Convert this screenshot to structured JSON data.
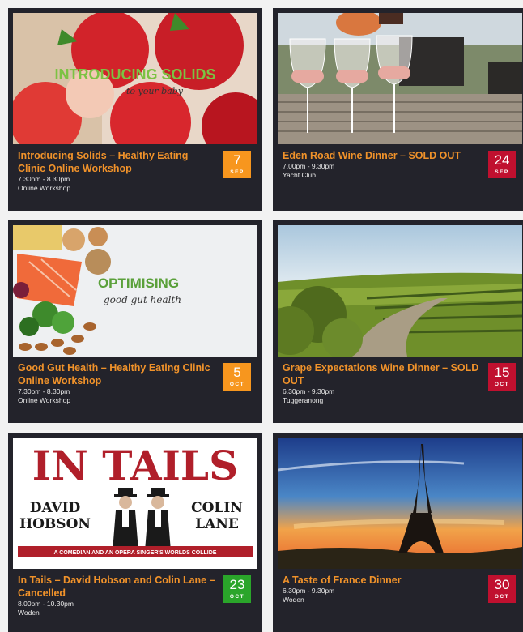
{
  "events": [
    {
      "title": "Introducing Solids – Healthy Eating Clinic Online Workshop",
      "time": "7.30pm - 8.30pm",
      "venue": "Online Workshop",
      "day": "7",
      "month": "SEP",
      "badge_color": "#f7961e",
      "image": {
        "heading": "INTRODUCING SOLIDS",
        "subheading": "to your baby"
      }
    },
    {
      "title": "Eden Road Wine Dinner – SOLD OUT",
      "time": "7.00pm - 9.30pm",
      "venue": "Yacht Club",
      "day": "24",
      "month": "SEP",
      "badge_color": "#c0102f"
    },
    {
      "title": "Good Gut Health – Healthy Eating Clinic Online Workshop",
      "time": "7.30pm - 8.30pm",
      "venue": "Online Workshop",
      "day": "5",
      "month": "OCT",
      "badge_color": "#f7961e",
      "image": {
        "heading": "OPTIMISING",
        "subheading": "good gut health"
      }
    },
    {
      "title": "Grape Expectations Wine Dinner – SOLD OUT",
      "time": "6.30pm - 9.30pm",
      "venue": "Tuggeranong",
      "day": "15",
      "month": "OCT",
      "badge_color": "#c0102f"
    },
    {
      "title": "In Tails – David Hobson and Colin Lane – Cancelled",
      "time": "8.00pm - 10.30pm",
      "venue": "Woden",
      "day": "23",
      "month": "OCT",
      "badge_color": "#2aa52a",
      "image": {
        "heading": "IN TAILS",
        "name_left_1": "DAVID",
        "name_left_2": "HOBSON",
        "name_right_1": "COLIN",
        "name_right_2": "LANE",
        "banner": "A COMEDIAN AND AN OPERA SINGER'S WORLDS COLLIDE"
      }
    },
    {
      "title": "A Taste of France Dinner",
      "time": "6.30pm - 9.30pm",
      "venue": "Woden",
      "day": "30",
      "month": "OCT",
      "badge_color": "#c0102f"
    }
  ]
}
